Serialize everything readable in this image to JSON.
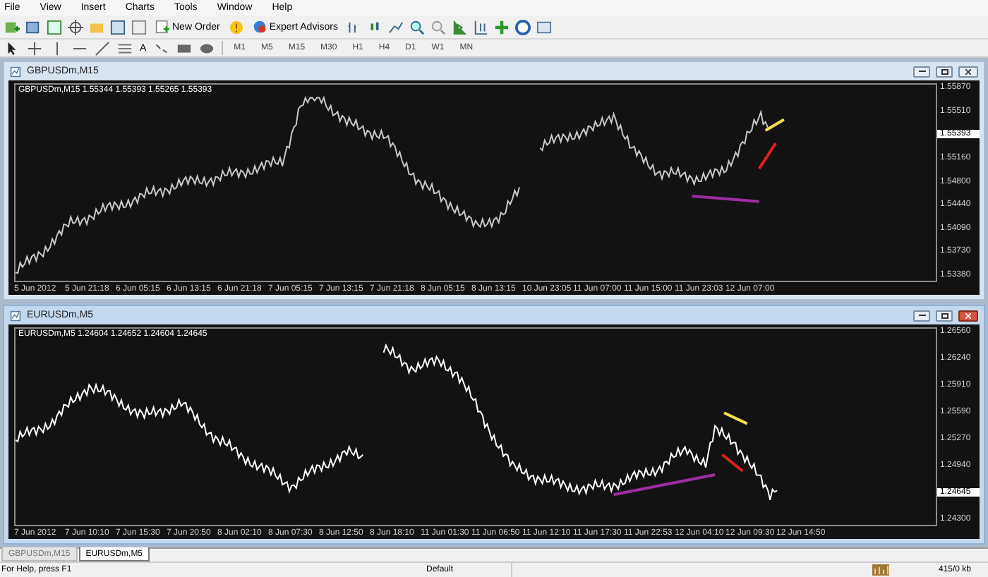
{
  "menu": [
    "File",
    "View",
    "Insert",
    "Charts",
    "Tools",
    "Window",
    "Help"
  ],
  "toolbar": {
    "new_order": "New Order",
    "expert_advisors": "Expert Advisors",
    "text_tool": "A",
    "timeframes": [
      {
        "label": "M1",
        "selected": false
      },
      {
        "label": "M5",
        "selected": false
      },
      {
        "label": "M15",
        "selected": false
      },
      {
        "label": "M30",
        "selected": false
      },
      {
        "label": "H1",
        "selected": false
      },
      {
        "label": "H4",
        "selected": false
      },
      {
        "label": "D1",
        "selected": false
      },
      {
        "label": "W1",
        "selected": false
      },
      {
        "label": "MN",
        "selected": false
      }
    ]
  },
  "charts": [
    {
      "title": "GBPUSDm,M15",
      "info": "GBPUSDm,M15  1.55344 1.55393 1.55265 1.55393",
      "active": false,
      "price_labels": [
        {
          "text": "1.55870",
          "kind": "tick"
        },
        {
          "text": "1.55510",
          "kind": "tick"
        },
        {
          "text": "1.55393",
          "kind": "current"
        },
        {
          "text": "1.55160",
          "kind": "tick"
        },
        {
          "text": "1.54800",
          "kind": "tick"
        },
        {
          "text": "1.54440",
          "kind": "tick"
        },
        {
          "text": "1.54090",
          "kind": "tick"
        },
        {
          "text": "1.53730",
          "kind": "tick"
        },
        {
          "text": "1.53380",
          "kind": "tick"
        }
      ],
      "time_labels": [
        "5 Jun 2012",
        "5 Jun 21:18",
        "6 Jun 05:15",
        "6 Jun 13:15",
        "6 Jun 21:18",
        "7 Jun 05:15",
        "7 Jun 13:15",
        "7 Jun 21:18",
        "8 Jun 05:15",
        "8 Jun 13:15",
        "10 Jun 23:05",
        "11 Jun 07:00",
        "11 Jun 15:00",
        "11 Jun 23:03",
        "12 Jun 07:00"
      ]
    },
    {
      "title": "EURUSDm,M5",
      "info": "EURUSDm,M5  1.24604 1.24652 1.24604 1.24645",
      "active": true,
      "price_labels": [
        {
          "text": "1.26560",
          "kind": "tick"
        },
        {
          "text": "1.26240",
          "kind": "tick"
        },
        {
          "text": "1.25910",
          "kind": "tick"
        },
        {
          "text": "1.25590",
          "kind": "tick"
        },
        {
          "text": "1.25270",
          "kind": "tick"
        },
        {
          "text": "1.24940",
          "kind": "tick"
        },
        {
          "text": "1.24645",
          "kind": "current"
        },
        {
          "text": "1.24300",
          "kind": "tick"
        }
      ],
      "time_labels": [
        "7 Jun 2012",
        "7 Jun 10:10",
        "7 Jun 15:30",
        "7 Jun 20:50",
        "8 Jun 02:10",
        "8 Jun 07:30",
        "8 Jun 12:50",
        "8 Jun 18:10",
        "11 Jun 01:30",
        "11 Jun 06:50",
        "11 Jun 12:10",
        "11 Jun 17:30",
        "11 Jun 22:53",
        "12 Jun 04:10",
        "12 Jun 09:30",
        "12 Jun 14:50"
      ]
    }
  ],
  "tabs": [
    {
      "label": "GBPUSDm,M15",
      "selected": false
    },
    {
      "label": "EURUSDm,M5",
      "selected": true
    }
  ],
  "status_bar": {
    "help": "For Help, press F1",
    "profile": "Default",
    "traffic": "415/0 kb"
  }
}
